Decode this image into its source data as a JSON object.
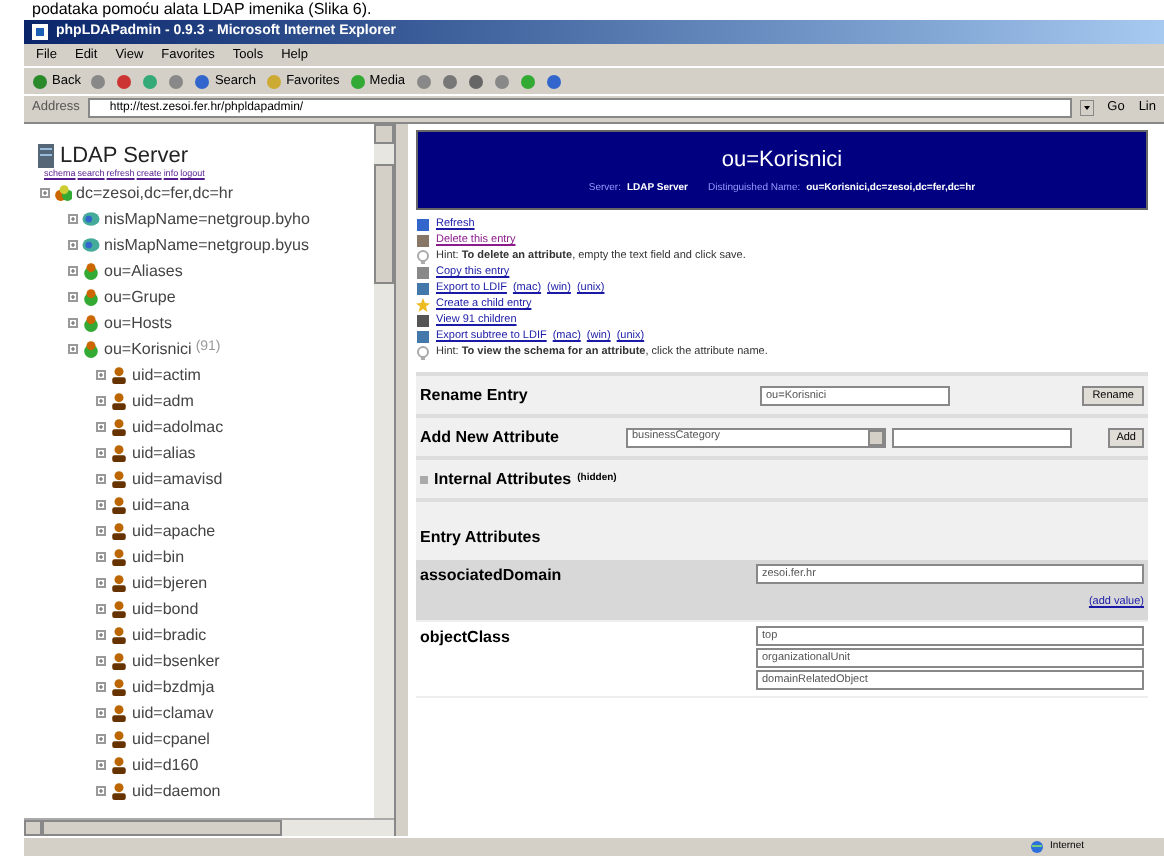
{
  "caption": "podataka pomoću alata LDAP imenika (Slika 6).",
  "window": {
    "title": "phpLDAPadmin - 0.9.3 - Microsoft Internet Explorer"
  },
  "menu": [
    "File",
    "Edit",
    "View",
    "Favorites",
    "Tools",
    "Help"
  ],
  "toolbar": [
    {
      "kind": "back",
      "label": "Back"
    },
    {
      "kind": "forward"
    },
    {
      "kind": "stop"
    },
    {
      "kind": "refresh"
    },
    {
      "kind": "home"
    },
    {
      "kind": "search",
      "label": "Search"
    },
    {
      "kind": "favorites",
      "label": "Favorites"
    },
    {
      "kind": "media",
      "label": "Media"
    },
    {
      "kind": "history"
    },
    {
      "kind": "mail"
    },
    {
      "kind": "print"
    },
    {
      "kind": "edit"
    },
    {
      "kind": "messenger"
    },
    {
      "kind": "research"
    }
  ],
  "address": {
    "label": "Address",
    "value": "http://test.zesoi.fer.hr/phpldapadmin/",
    "go": "Go",
    "links": "Lin"
  },
  "tree": {
    "server": "LDAP Server",
    "server_links": [
      "schema",
      "search",
      "refresh",
      "create",
      "info",
      "logout"
    ],
    "root": {
      "kind": "domain",
      "label": "dc=zesoi,dc=fer,dc=hr",
      "children": [
        {
          "kind": "nis",
          "label": "nisMapName=netgroup.byho"
        },
        {
          "kind": "nis",
          "label": "nisMapName=netgroup.byus"
        },
        {
          "kind": "ou",
          "label": "ou=Aliases"
        },
        {
          "kind": "ou",
          "label": "ou=Grupe"
        },
        {
          "kind": "ou",
          "label": "ou=Hosts"
        },
        {
          "kind": "ou",
          "label": "ou=Korisnici",
          "count": "(91)",
          "children": [
            {
              "kind": "user",
              "label": "uid=actim"
            },
            {
              "kind": "user",
              "label": "uid=adm"
            },
            {
              "kind": "user",
              "label": "uid=adolmac"
            },
            {
              "kind": "user",
              "label": "uid=alias"
            },
            {
              "kind": "user",
              "label": "uid=amavisd"
            },
            {
              "kind": "user",
              "label": "uid=ana"
            },
            {
              "kind": "user",
              "label": "uid=apache"
            },
            {
              "kind": "user",
              "label": "uid=bin"
            },
            {
              "kind": "user",
              "label": "uid=bjeren"
            },
            {
              "kind": "user",
              "label": "uid=bond"
            },
            {
              "kind": "user",
              "label": "uid=bradic"
            },
            {
              "kind": "user",
              "label": "uid=bsenker"
            },
            {
              "kind": "user",
              "label": "uid=bzdmja"
            },
            {
              "kind": "user",
              "label": "uid=clamav"
            },
            {
              "kind": "user",
              "label": "uid=cpanel"
            },
            {
              "kind": "user",
              "label": "uid=d160"
            },
            {
              "kind": "user",
              "label": "uid=daemon"
            }
          ]
        }
      ]
    }
  },
  "entry": {
    "title": "ou=Korisnici",
    "info": [
      {
        "key": "Server:",
        "value": "LDAP Server"
      },
      {
        "key": "Distinguished Name:",
        "value": "ou=Korisnici,dc=zesoi,dc=fer,dc=hr"
      }
    ],
    "actions": [
      {
        "kind": "refresh",
        "text": "Refresh"
      },
      {
        "kind": "delete",
        "text": "Delete this entry"
      },
      {
        "kind": "hint",
        "text": "Hint: **To delete an attribute**, empty the text field and click save."
      },
      {
        "kind": "copy",
        "text": "Copy this entry"
      },
      {
        "kind": "export",
        "text": "Export to LDIF",
        "formats": [
          "(mac)",
          "(win)",
          "(unix)"
        ]
      },
      {
        "kind": "create",
        "text": "Create a child entry"
      },
      {
        "kind": "children",
        "text": "View 91 children"
      },
      {
        "kind": "export",
        "text": "Export subtree to LDIF",
        "formats": [
          "(mac)",
          "(win)",
          "(unix)"
        ]
      },
      {
        "kind": "hint",
        "text": "Hint: **To view the schema for an attribute**, click the attribute name."
      }
    ],
    "rename": {
      "label": "Rename Entry",
      "value": "ou=Korisnici",
      "button": "Rename"
    },
    "add_attribute": {
      "label": "Add New Attribute",
      "select": "businessCategory",
      "button": "Add"
    },
    "internal": {
      "label": "Internal Attributes",
      "note": "(hidden)"
    },
    "attributes_heading": "Entry Attributes",
    "attributes": [
      {
        "name": "associatedDomain",
        "selected": true,
        "values": [
          "zesoi.fer.hr"
        ],
        "add": "(add value)"
      },
      {
        "name": "objectClass",
        "selected": false,
        "values": [
          "top",
          "organizationalUnit",
          "domainRelatedObject"
        ]
      }
    ]
  },
  "status_bar": {
    "zone": "Internet"
  }
}
